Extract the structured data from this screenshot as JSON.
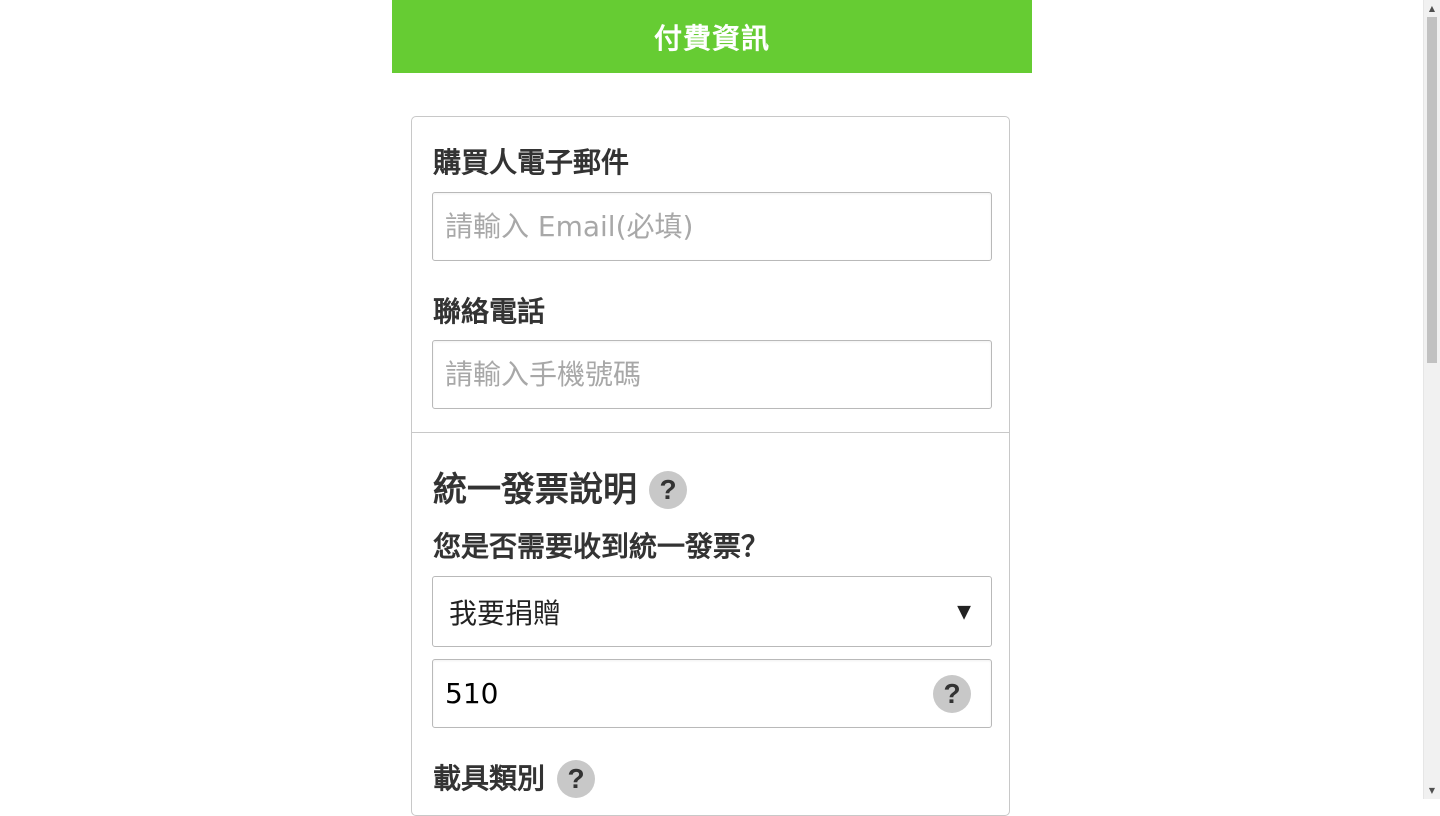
{
  "header": {
    "title": "付費資訊"
  },
  "form": {
    "email": {
      "label": "購買人電子郵件",
      "placeholder": "請輸入 Email(必填)",
      "value": ""
    },
    "phone": {
      "label": "聯絡電話",
      "placeholder": "請輸入手機號碼",
      "value": ""
    },
    "invoice": {
      "section_title": "統一發票說明",
      "question": "您是否需要收到統一發票？",
      "selected_option": "我要捐贈",
      "caret": "▼",
      "donation_code": "510"
    },
    "carrier": {
      "label": "載具類別"
    },
    "help_glyph": "?"
  },
  "colors": {
    "header_bg": "#66cc33",
    "header_text": "#ffffff",
    "help_icon_bg": "#c8c8c8"
  }
}
